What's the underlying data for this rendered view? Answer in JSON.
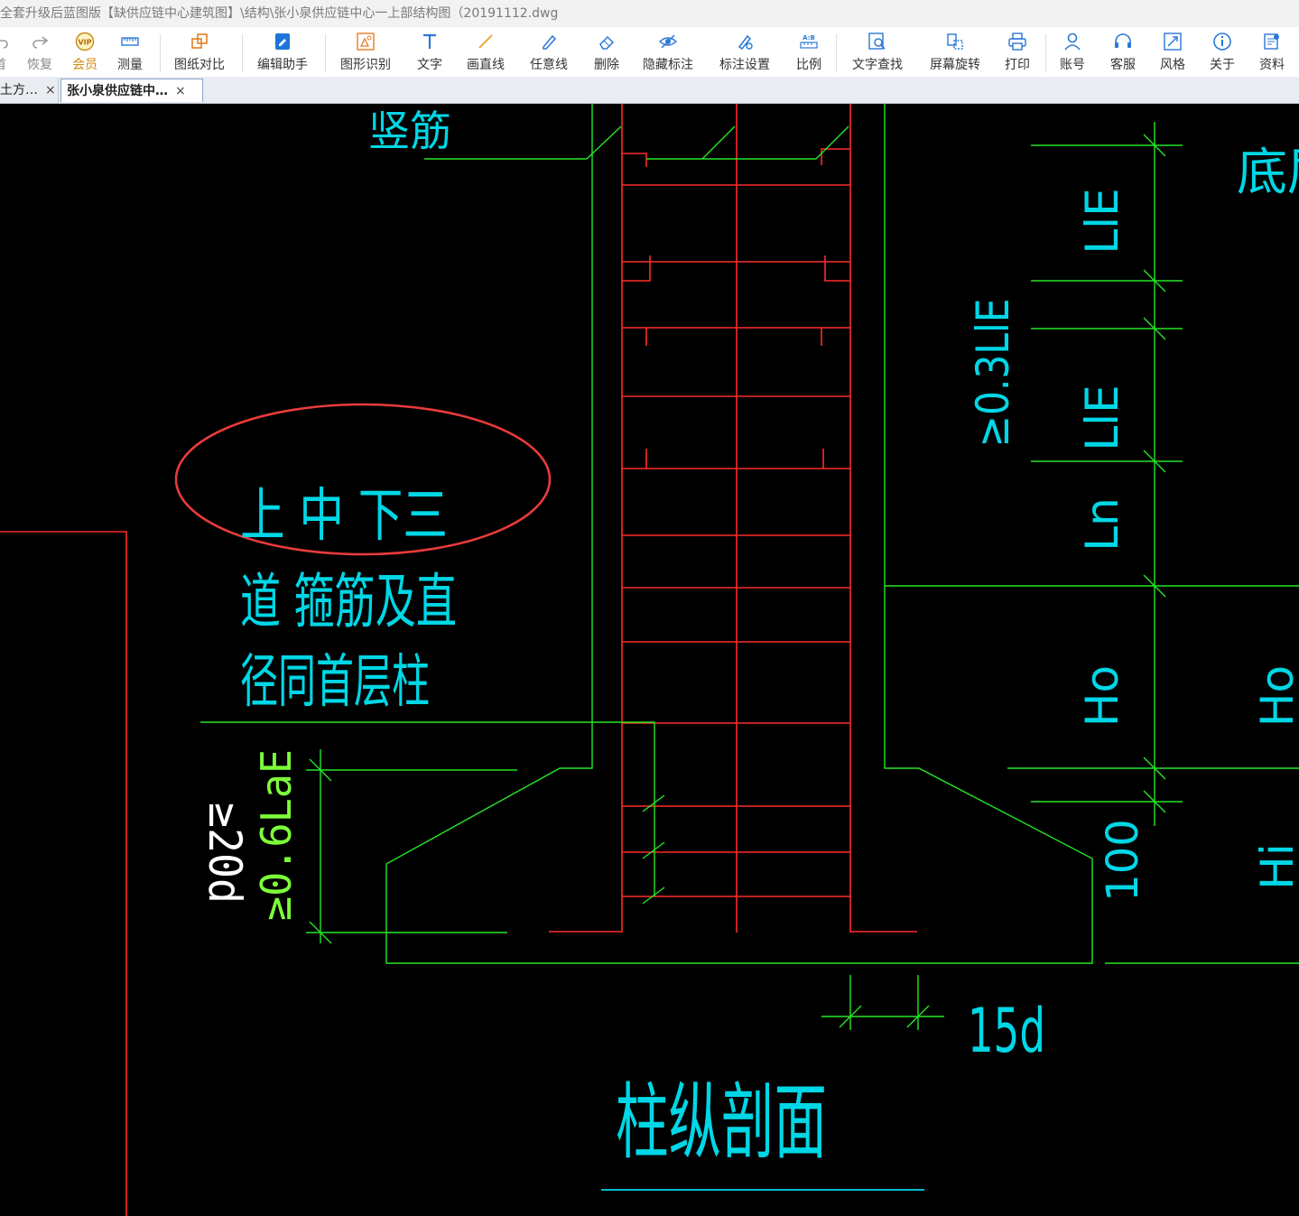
{
  "window": {
    "title": "全套升级后蓝图版【缺供应链中心建筑图】\\结构\\张小泉供应链中心一上部结构图（20191112.dwg"
  },
  "toolbar": {
    "items": [
      {
        "id": "undo",
        "label": "首",
        "icon": "undo-icon"
      },
      {
        "id": "redo",
        "label": "恢复",
        "icon": "redo-icon"
      },
      {
        "id": "vip",
        "label": "会员",
        "icon": "vip-icon"
      },
      {
        "id": "measure",
        "label": "测量",
        "icon": "ruler-icon"
      },
      {
        "id": "compare",
        "label": "图纸对比",
        "icon": "compare-icon"
      },
      {
        "id": "edit",
        "label": "编辑助手",
        "icon": "edit-assistant-icon"
      },
      {
        "id": "recognize",
        "label": "图形识别",
        "icon": "shape-recognize-icon"
      },
      {
        "id": "text",
        "label": "文字",
        "icon": "text-icon"
      },
      {
        "id": "line",
        "label": "画直线",
        "icon": "line-icon"
      },
      {
        "id": "freehand",
        "label": "任意线",
        "icon": "pen-icon"
      },
      {
        "id": "delete",
        "label": "删除",
        "icon": "eraser-icon"
      },
      {
        "id": "hide",
        "label": "隐藏标注",
        "icon": "eye-hide-icon"
      },
      {
        "id": "annotate",
        "label": "标注设置",
        "icon": "annotation-settings-icon"
      },
      {
        "id": "scale",
        "label": "比例",
        "icon": "scale-icon"
      },
      {
        "id": "find",
        "label": "文字查找",
        "icon": "text-search-icon"
      },
      {
        "id": "rotate",
        "label": "屏幕旋转",
        "icon": "rotate-icon"
      },
      {
        "id": "print",
        "label": "打印",
        "icon": "printer-icon"
      },
      {
        "id": "account",
        "label": "账号",
        "icon": "user-icon"
      },
      {
        "id": "service",
        "label": "客服",
        "icon": "headset-icon"
      },
      {
        "id": "style",
        "label": "风格",
        "icon": "style-icon"
      },
      {
        "id": "about",
        "label": "关于",
        "icon": "info-icon"
      },
      {
        "id": "docs",
        "label": "资料",
        "icon": "docs-icon"
      }
    ]
  },
  "tabs": [
    {
      "label": "土方…",
      "close": "×"
    },
    {
      "label": "张小泉供应链中…",
      "close": "×"
    }
  ],
  "drawing": {
    "top_label": "竖筋",
    "note_line1": "上 中 下三",
    "note_line2": "道 箍筋及直",
    "note_line3": "径同首层柱",
    "dim_03lle": "≥0.3LlE",
    "dim_lle_top": "LlE",
    "dim_lle_mid": "LlE",
    "dim_ln": "Ln",
    "dim_ho_left": "Ho",
    "dim_ho_right": "Ho",
    "dim_hi": "Hi",
    "dim_100": "100",
    "dim_06lae": "≥0.6LaE",
    "dim_20d": "≥20d",
    "dim_15d": "15d",
    "corner_text": "底层",
    "section_title": "柱纵剖面"
  },
  "colors": {
    "rebar": "#ff2b2b",
    "outline": "#26e626",
    "annotation": "#00d7e6",
    "highlight": "#e83b3b"
  }
}
